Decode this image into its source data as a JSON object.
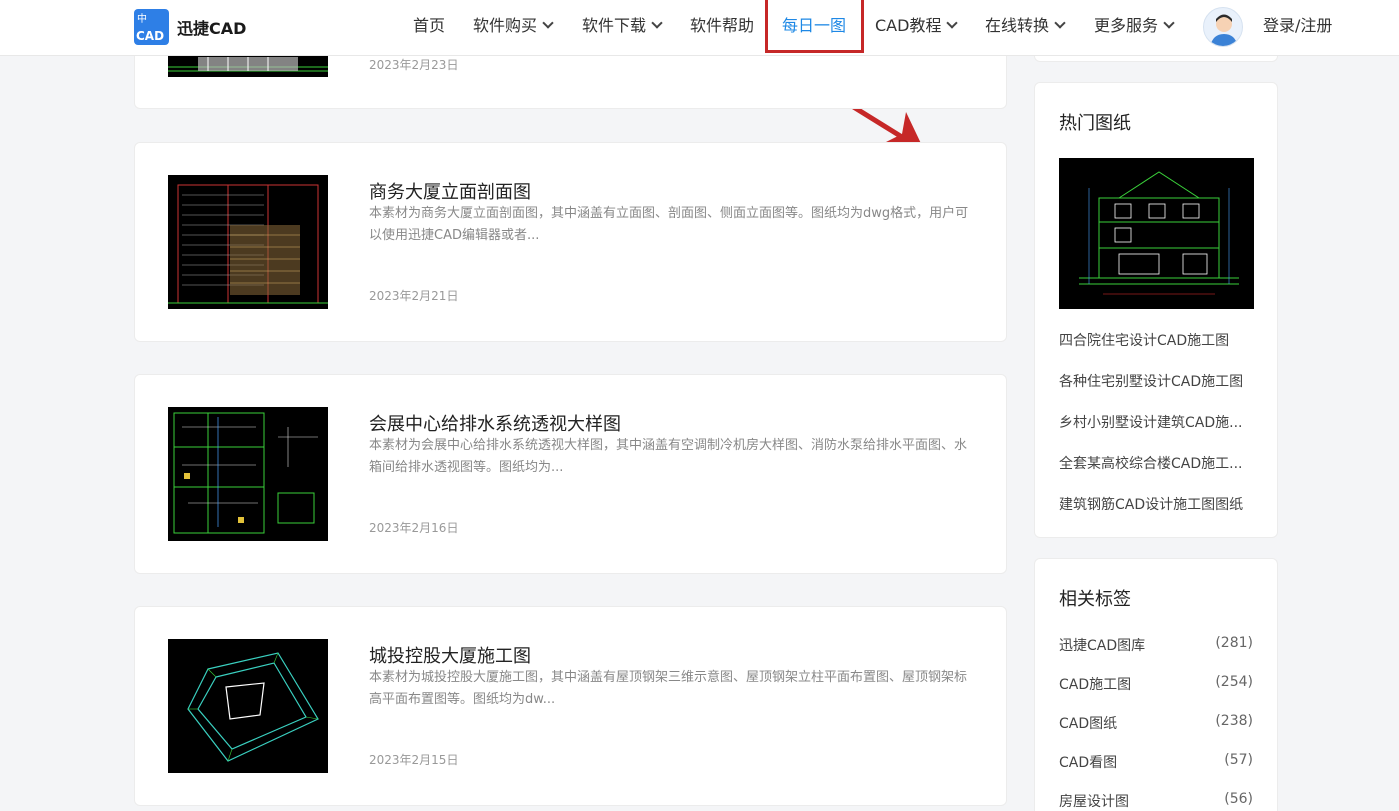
{
  "header": {
    "logo_mark_top": "中",
    "logo_mark_bottom": "CAD",
    "logo_text": "迅捷CAD",
    "nav": [
      {
        "label": "首页",
        "has_dropdown": false
      },
      {
        "label": "软件购买",
        "has_dropdown": true
      },
      {
        "label": "软件下载",
        "has_dropdown": true
      },
      {
        "label": "软件帮助",
        "has_dropdown": false
      },
      {
        "label": "每日一图",
        "has_dropdown": false,
        "active": true
      },
      {
        "label": "CAD教程",
        "has_dropdown": true
      },
      {
        "label": "在线转换",
        "has_dropdown": true
      },
      {
        "label": "更多服务",
        "has_dropdown": true
      }
    ],
    "login": "登录/注册"
  },
  "articles": [
    {
      "title": "",
      "desc": "",
      "date": "2023年2月23日"
    },
    {
      "title": "商务大厦立面剖面图",
      "desc": "本素材为商务大厦立面剖面图，其中涵盖有立面图、剖面图、侧面立面图等。图纸均为dwg格式，用户可以使用迅捷CAD编辑器或者...",
      "date": "2023年2月21日"
    },
    {
      "title": "会展中心给排水系统透视大样图",
      "desc": "本素材为会展中心给排水系统透视大样图，其中涵盖有空调制冷机房大样图、消防水泵给排水平面图、水箱间给排水透视图等。图纸均为...",
      "date": "2023年2月16日"
    },
    {
      "title": "城投控股大厦施工图",
      "desc": "本素材为城投控股大厦施工图，其中涵盖有屋顶钢架三维示意图、屋顶钢架立柱平面布置图、屋顶钢架标高平面布置图等。图纸均为dw...",
      "date": "2023年2月15日"
    }
  ],
  "sidebar": {
    "hot_title": "热门图纸",
    "hot_links": [
      "四合院住宅设计CAD施工图",
      "各种住宅别墅设计CAD施工图",
      "乡村小别墅设计建筑CAD施...",
      "全套某高校综合楼CAD施工...",
      "建筑钢筋CAD设计施工图图纸"
    ],
    "tags_title": "相关标签",
    "tags": [
      {
        "name": "迅捷CAD图库",
        "count": "(281)"
      },
      {
        "name": "CAD施工图",
        "count": "(254)"
      },
      {
        "name": "CAD图纸",
        "count": "(238)"
      },
      {
        "name": "CAD看图",
        "count": "(57)"
      },
      {
        "name": "房屋设计图",
        "count": "(56)"
      }
    ]
  },
  "colors": {
    "accent": "#1e88e5",
    "highlight": "#c62828",
    "logo": "#2e7fe6"
  }
}
